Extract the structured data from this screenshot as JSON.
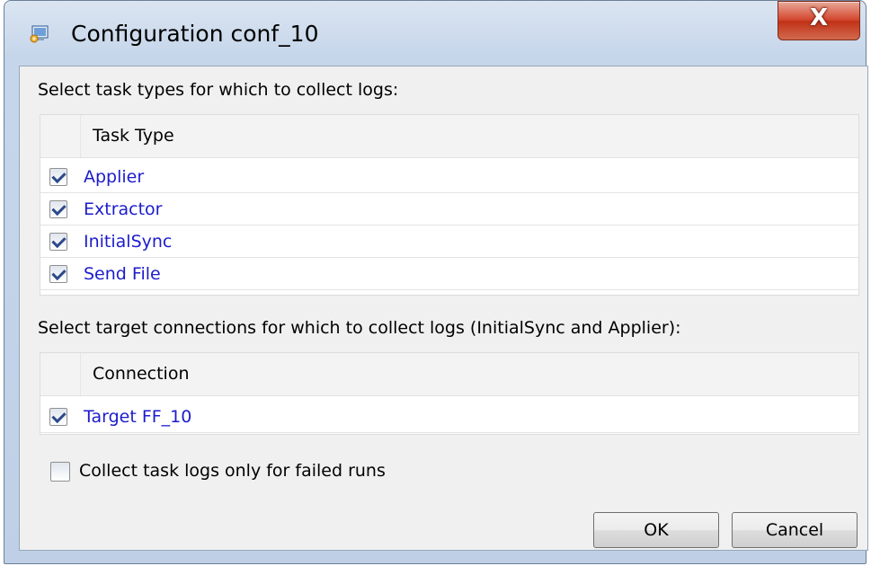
{
  "window": {
    "title": "Configuration conf_10",
    "close_glyph": "X",
    "icon": "configuration-app-icon"
  },
  "task_section": {
    "prompt": "Select task types for which to collect logs:",
    "column_header": "Task Type",
    "rows": [
      {
        "label": "Applier",
        "checked": true
      },
      {
        "label": "Extractor",
        "checked": true
      },
      {
        "label": "InitialSync",
        "checked": true
      },
      {
        "label": "Send File",
        "checked": true
      }
    ]
  },
  "connection_section": {
    "prompt": "Select target connections for which to collect logs (InitialSync and Applier):",
    "column_header": "Connection",
    "rows": [
      {
        "label": "Target FF_10",
        "checked": true
      }
    ]
  },
  "failed_runs_option": {
    "label": "Collect task logs only for failed runs",
    "checked": false
  },
  "buttons": {
    "ok": "OK",
    "cancel": "Cancel"
  },
  "colors": {
    "link_text": "#1c1ccc",
    "close_button": "#c03217"
  }
}
